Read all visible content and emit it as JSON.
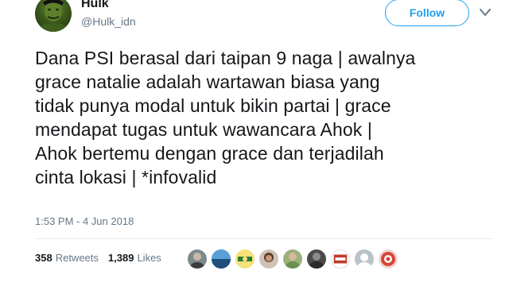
{
  "user": {
    "display_name": "Hulk",
    "handle": "@Hulk_idn",
    "follow_label": "Follow"
  },
  "tweet": {
    "lines": [
      "Dana PSI berasal dari taipan 9 naga | awalnya",
      "grace natalie adalah wartawan biasa yang",
      "tidak punya modal untuk bikin partai | grace",
      "mendapat tugas untuk wawancara Ahok |",
      "Ahok bertemu dengan grace dan terjadilah",
      "cinta lokasi | *infovalid"
    ],
    "timestamp": "1:53 PM - 4 Jun 2018"
  },
  "stats": {
    "retweets_count": "358",
    "retweets_label": "Retweets",
    "likes_count": "1,389",
    "likes_label": "Likes"
  },
  "likers": [
    {
      "icon": "liker-avatar-1",
      "color": "#7d8a8c"
    },
    {
      "icon": "liker-avatar-2",
      "color": "#2e6fa8"
    },
    {
      "icon": "liker-avatar-3",
      "color": "#d9c84a"
    },
    {
      "icon": "liker-avatar-4",
      "color": "#8a4a3a"
    },
    {
      "icon": "liker-avatar-5",
      "color": "#6a8f4e"
    },
    {
      "icon": "liker-avatar-6",
      "color": "#4a4a4a"
    },
    {
      "icon": "liker-avatar-7",
      "color": "#c0392b"
    },
    {
      "icon": "liker-avatar-8",
      "color": "#b8c2c8"
    },
    {
      "icon": "liker-avatar-9",
      "color": "#d4453a"
    }
  ],
  "colors": {
    "accent": "#1da1f2",
    "text": "#14171a",
    "muted": "#657786",
    "divider": "#e6ecf0"
  }
}
